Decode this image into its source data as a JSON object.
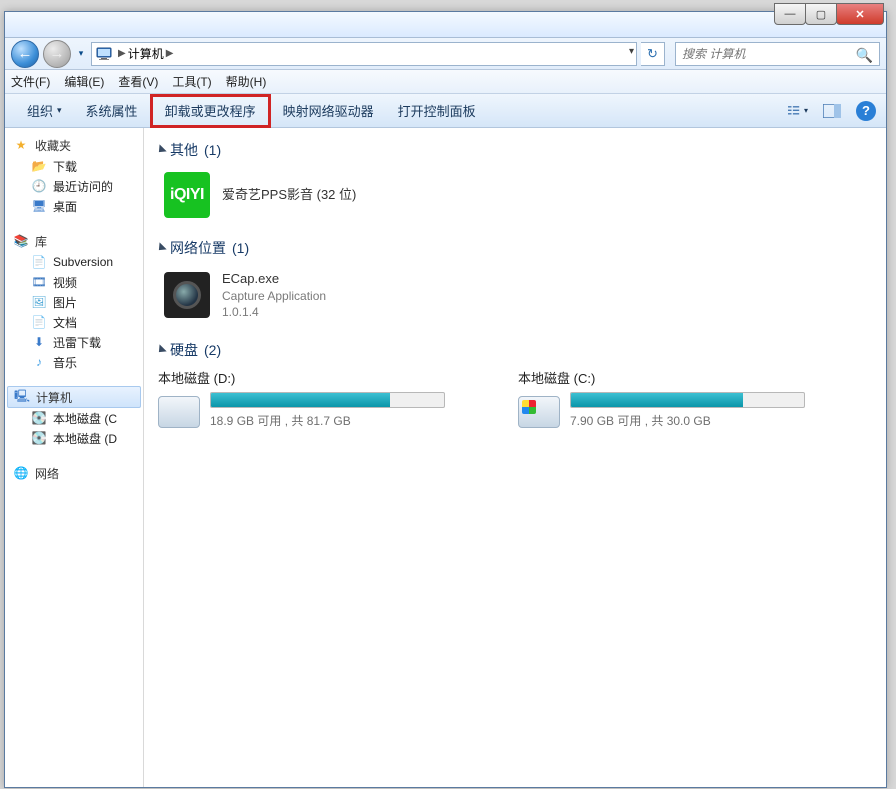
{
  "titlebar": {
    "min": "—",
    "max": "▢",
    "close": "✕"
  },
  "nav": {
    "back": "←",
    "fwd": "→",
    "path_label": "计算机",
    "sep": "▶",
    "search_placeholder": "搜索 计算机"
  },
  "menu": {
    "file": "文件(F)",
    "edit": "编辑(E)",
    "view": "查看(V)",
    "tools": "工具(T)",
    "help": "帮助(H)"
  },
  "cmdbar": {
    "organize": "组织",
    "sysprops": "系统属性",
    "uninstall": "卸载或更改程序",
    "mapdrive": "映射网络驱动器",
    "ctrlpanel": "打开控制面板"
  },
  "sidebar": {
    "fav": "收藏夹",
    "fav_items": [
      "下载",
      "最近访问的",
      "桌面"
    ],
    "lib": "库",
    "lib_items": [
      "Subversion",
      "视频",
      "图片",
      "文档",
      "迅雷下载",
      "音乐"
    ],
    "computer": "计算机",
    "drives": [
      "本地磁盘 (C",
      "本地磁盘 (D"
    ],
    "network": "网络"
  },
  "content": {
    "groups": [
      {
        "title": "其他",
        "count": "(1)",
        "items": [
          {
            "name": "爱奇艺PPS影音 (32 位)",
            "icon": "iqiyi",
            "icon_text": "iQIYI"
          }
        ]
      },
      {
        "title": "网络位置",
        "count": "(1)",
        "items": [
          {
            "name": "ECap.exe",
            "sub1": "Capture Application",
            "sub2": "1.0.1.4",
            "icon": "cam"
          }
        ]
      },
      {
        "title": "硬盘",
        "count": "(2)",
        "drives": [
          {
            "name": "本地磁盘 (D:)",
            "free": "18.9 GB 可用 , 共 81.7 GB",
            "pct": 77,
            "win": false
          },
          {
            "name": "本地磁盘 (C:)",
            "free": "7.90 GB 可用 , 共 30.0 GB",
            "pct": 74,
            "win": true
          }
        ]
      }
    ]
  }
}
